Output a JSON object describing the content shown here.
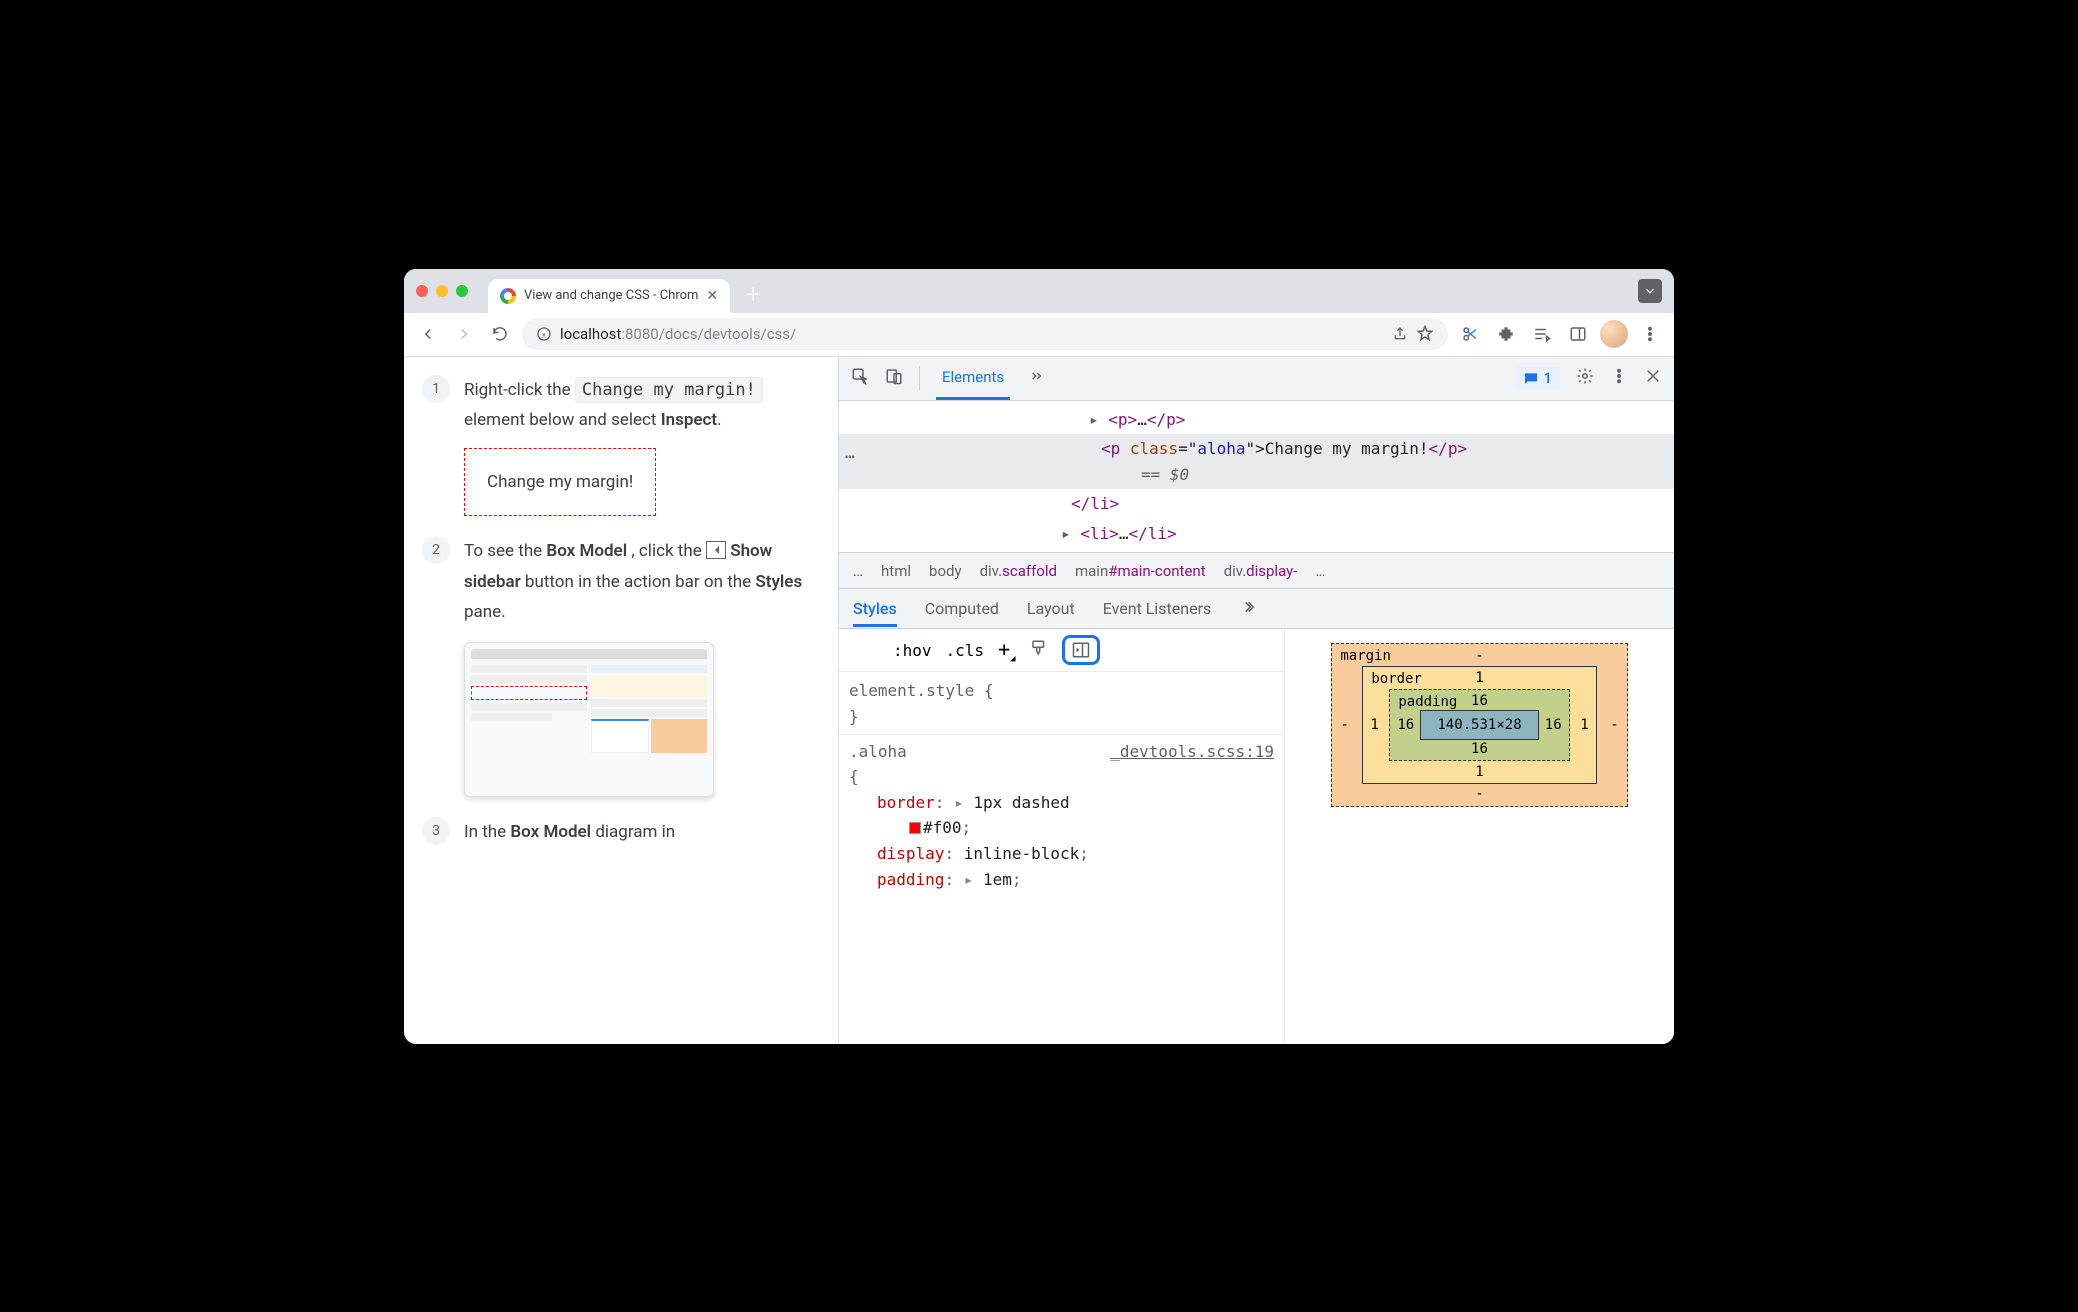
{
  "tab": {
    "title": "View and change CSS - Chrom"
  },
  "url": {
    "host": "localhost",
    "port": ":8080",
    "path": "/docs/devtools/css/"
  },
  "docs": {
    "step1": {
      "num": "1",
      "t1": "Right-click the ",
      "code": "Change my margin!",
      "t2": " element below and select ",
      "bold": "Inspect",
      "t3": ".",
      "demo": "Change my margin!"
    },
    "step2": {
      "num": "2",
      "t1": "To see the ",
      "b1": "Box Model",
      "t2": ", click the ",
      "b2": "Show sidebar",
      "t3": " button in the action bar on the ",
      "b3": "Styles",
      "t4": " pane."
    },
    "step3": {
      "num": "3",
      "t1": "In the ",
      "b1": "Box Model",
      "t2": " diagram in"
    }
  },
  "devtools": {
    "panel": "Elements",
    "issues": "1",
    "dom": {
      "r1a": "<p>",
      "r1b": "…",
      "r1c": "</p>",
      "r2a": "<p ",
      "r2attr": "class",
      "r2eq": "=\"",
      "r2val": "aloha",
      "r2eq2": "\">",
      "r2txt": "Change my margin!",
      "r2close": "</p>",
      "r2sel": "== $0",
      "r3": "</li>",
      "r4a": "<li>",
      "r4b": "…",
      "r4c": "</li>"
    },
    "bc": {
      "dots": "…",
      "html": "html",
      "body": "body",
      "div1a": "div",
      "div1b": ".scaffold",
      "main1a": "main",
      "main1b": "#main-content",
      "div2a": "div",
      "div2b": ".display-",
      "more": "…"
    },
    "subtabs": {
      "styles": "Styles",
      "computed": "Computed",
      "layout": "Layout",
      "listeners": "Event Listeners"
    },
    "filter": {
      "hov": ":hov",
      "cls": ".cls"
    },
    "rules": {
      "r1": "element.style {",
      "r1b": "}",
      "r2sel": ".aloha",
      "r2src": "_devtools.scss:19",
      "r2open": "{",
      "p1": "border",
      "v1a": "1px dashed",
      "v1b": "#f00",
      "p2": "display",
      "v2": "inline-block",
      "p3": "padding",
      "v3": "1em"
    },
    "box": {
      "margin": "margin",
      "border": "border",
      "padding": "padding",
      "dash": "-",
      "b": "1",
      "p": "16",
      "content": "140.531×28"
    }
  }
}
